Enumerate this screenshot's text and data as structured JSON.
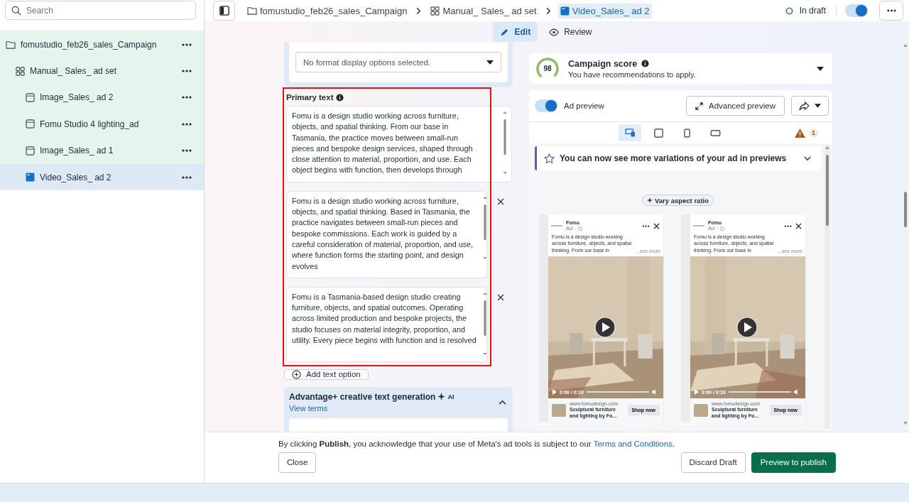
{
  "sidebar": {
    "search": {
      "placeholder": "Search"
    },
    "tree": [
      {
        "kind": "campaign",
        "label": "fomustudio_feb26_sales_Campaign",
        "children": [
          {
            "kind": "ad_set",
            "label": "Manual_ Sales_ ad set",
            "children": [
              {
                "kind": "ad",
                "label": "Image_Sales_ ad 2",
                "selected": false
              },
              {
                "kind": "ad",
                "label": "Fomu Studio 4 lighting_ad",
                "selected": false
              },
              {
                "kind": "ad",
                "label": "Image_Sales_ ad 1",
                "selected": false
              },
              {
                "kind": "ad",
                "label": "Video_Sales_ ad 2",
                "selected": true
              }
            ]
          }
        ]
      }
    ]
  },
  "breadcrumbs": [
    {
      "kind": "campaign",
      "label": "fomustudio_feb26_sales_Campaign",
      "selected": false
    },
    {
      "kind": "ad_set",
      "label": "Manual_ Sales_ ad set",
      "selected": false
    },
    {
      "kind": "ad",
      "label": "Video_Sales_ ad 2",
      "selected": true
    }
  ],
  "status": {
    "label": "In draft",
    "toggle_on": true
  },
  "mode_tabs": [
    {
      "kind": "edit",
      "label": "Edit",
      "selected": true
    },
    {
      "kind": "review",
      "label": "Review",
      "selected": false
    }
  ],
  "form": {
    "format_dropdown": {
      "value": "No format display options selected."
    },
    "primary_text": {
      "label": "Primary text",
      "highlighted": true,
      "options": [
        {
          "text": "Fomu is a design studio working across furniture, objects, and spatial thinking. From our base in Tasmania, the practice moves between small-run pieces and bespoke design services, shaped through close attention to material, proportion, and use. Each object begins with function, then develops through",
          "removable": false
        },
        {
          "text": "Fomu is a design studio working across furniture, objects, and spatial thinking. Based in Tasmania, the practice navigates between small-run pieces and bespoke commissions. Each work is guided by a careful consideration of material, proportion, and use, where function forms the starting point, and design evolves",
          "removable": true
        },
        {
          "text": "Fomu is a Tasmania-based design studio creating furniture, objects, and spatial outcomes. Operating across limited production and bespoke projects, the studio focuses on material integrity, proportion, and utility. Every piece begins with function and is resolved",
          "removable": true
        }
      ]
    },
    "add_button": "Add text option",
    "advantage": {
      "title": "Advantage+ creative text generation",
      "badge": "AI",
      "link": "View terms",
      "expanded": true
    }
  },
  "campaign_score": {
    "score": "98",
    "title": "Campaign score",
    "subtitle": "You have recommendations to apply.",
    "expanded": false
  },
  "preview": {
    "toggle": {
      "label": "Ad preview",
      "on": true
    },
    "advanced_button": "Advanced preview",
    "placements": [
      {
        "kind": "multi",
        "selected": true
      },
      {
        "kind": "square",
        "selected": false
      },
      {
        "kind": "vertical",
        "selected": false
      },
      {
        "kind": "horizontal",
        "selected": false
      }
    ],
    "warning_count": "1",
    "banner": "You can now see more variations of your ad in previews",
    "vary_chip": "Vary aspect ratio",
    "ads": [
      {
        "page": "Fomu",
        "sponsored": "Ad ·",
        "text": "Fomu is a design studio working across furniture, objects, and spatial thinking. From our base in",
        "see_more": "...see more",
        "time": "0:00 / 0:10",
        "url": "www.fomudesign.com",
        "headline": "Sculptural furniture and lighting by Fo...",
        "cta": "Shop now"
      },
      {
        "page": "Fomu",
        "sponsored": "Ad ·",
        "text": "Fomu is a design studio working across furniture, objects, and spatial thinking. From our base in",
        "see_more": "...see more",
        "time": "0:00 / 0:10",
        "url": "www.fomudesign.com",
        "headline": "Sculptural furniture and lighting by Fo...",
        "cta": "Shop now"
      }
    ]
  },
  "footer": {
    "notice_before": "By clicking **Publish**, you acknowledge that your use of Meta's ad tools is subject to our ",
    "link": "Terms and Conditions",
    "notice_after": ".",
    "buttons": [
      {
        "kind": "close",
        "label": "Close"
      },
      {
        "kind": "secondary",
        "label": "Discard Draft"
      },
      {
        "kind": "primary",
        "label": "Preview to publish"
      }
    ]
  }
}
